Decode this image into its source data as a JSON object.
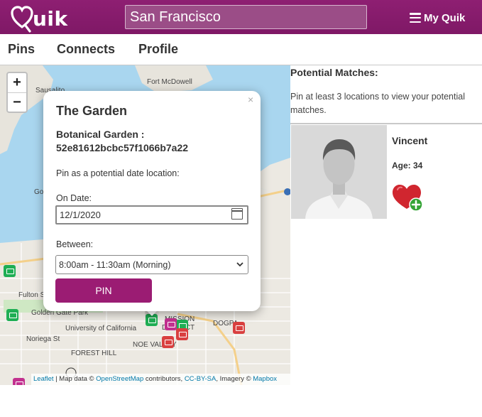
{
  "app": {
    "name": "uik",
    "brand_color": "#8a1c6e",
    "accent_color": "#9b1c73"
  },
  "header": {
    "search_value": "San Francisco",
    "my_quik_label": "My Quik"
  },
  "nav": {
    "items": [
      "Pins",
      "Connects",
      "Profile"
    ]
  },
  "map": {
    "zoom_in": "+",
    "zoom_out": "−",
    "labels": [
      "Sausalito",
      "Fort McDowell",
      "Go",
      "Fulton St",
      "Golden Gate Park",
      "University of California",
      "Noriega St",
      "FOREST HILL",
      "NOE VALLEY",
      "DOGPA",
      "MISSION",
      "DISTRICT"
    ],
    "attribution": {
      "leaflet": "Leaflet",
      "sep1": " | Map data © ",
      "osm": "OpenStreetMap",
      "sep2": " contributors, ",
      "license": "CC-BY-SA",
      "sep3": ", Imagery © ",
      "mapbox": "Mapbox"
    }
  },
  "popup": {
    "close": "×",
    "title": "The Garden",
    "subtitle": "Botanical Garden : 52e81612bcbc57f1066b7a22",
    "instruction": "Pin as a potential date location:",
    "date_label": "On Date:",
    "date_value": "12/1/2020",
    "between_label": "Between:",
    "time_selected": "8:00am - 11:30am (Morning)",
    "pin_label": "PIN"
  },
  "matches": {
    "title": "Potential Matches:",
    "hint": "Pin at least 3 locations to view your potential matches.",
    "items": [
      {
        "name": "Vincent",
        "age_text": "Age: 34"
      }
    ]
  }
}
